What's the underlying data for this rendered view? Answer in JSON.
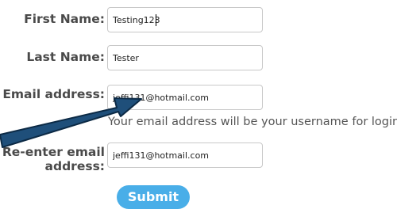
{
  "form": {
    "first_name": {
      "label": "First Name:",
      "value": "Testing123"
    },
    "last_name": {
      "label": "Last Name:",
      "value": "Tester"
    },
    "email": {
      "label": "Email address:",
      "value": "jeffi131@hotmail.com",
      "hint": "Your email address will be your username for login."
    },
    "reenter_email": {
      "label_line1": "Re-enter email",
      "label_line2": "address:",
      "value": "jeffi131@hotmail.com"
    },
    "submit_label": "Submit"
  },
  "annotation": {
    "icon": "arrow-icon",
    "fill_color": "#1f4f7a",
    "stroke_color": "#0c2a45"
  },
  "colors": {
    "label": "#4a4a4a",
    "button": "#49aee8",
    "field_border": "#c8c8c8"
  }
}
